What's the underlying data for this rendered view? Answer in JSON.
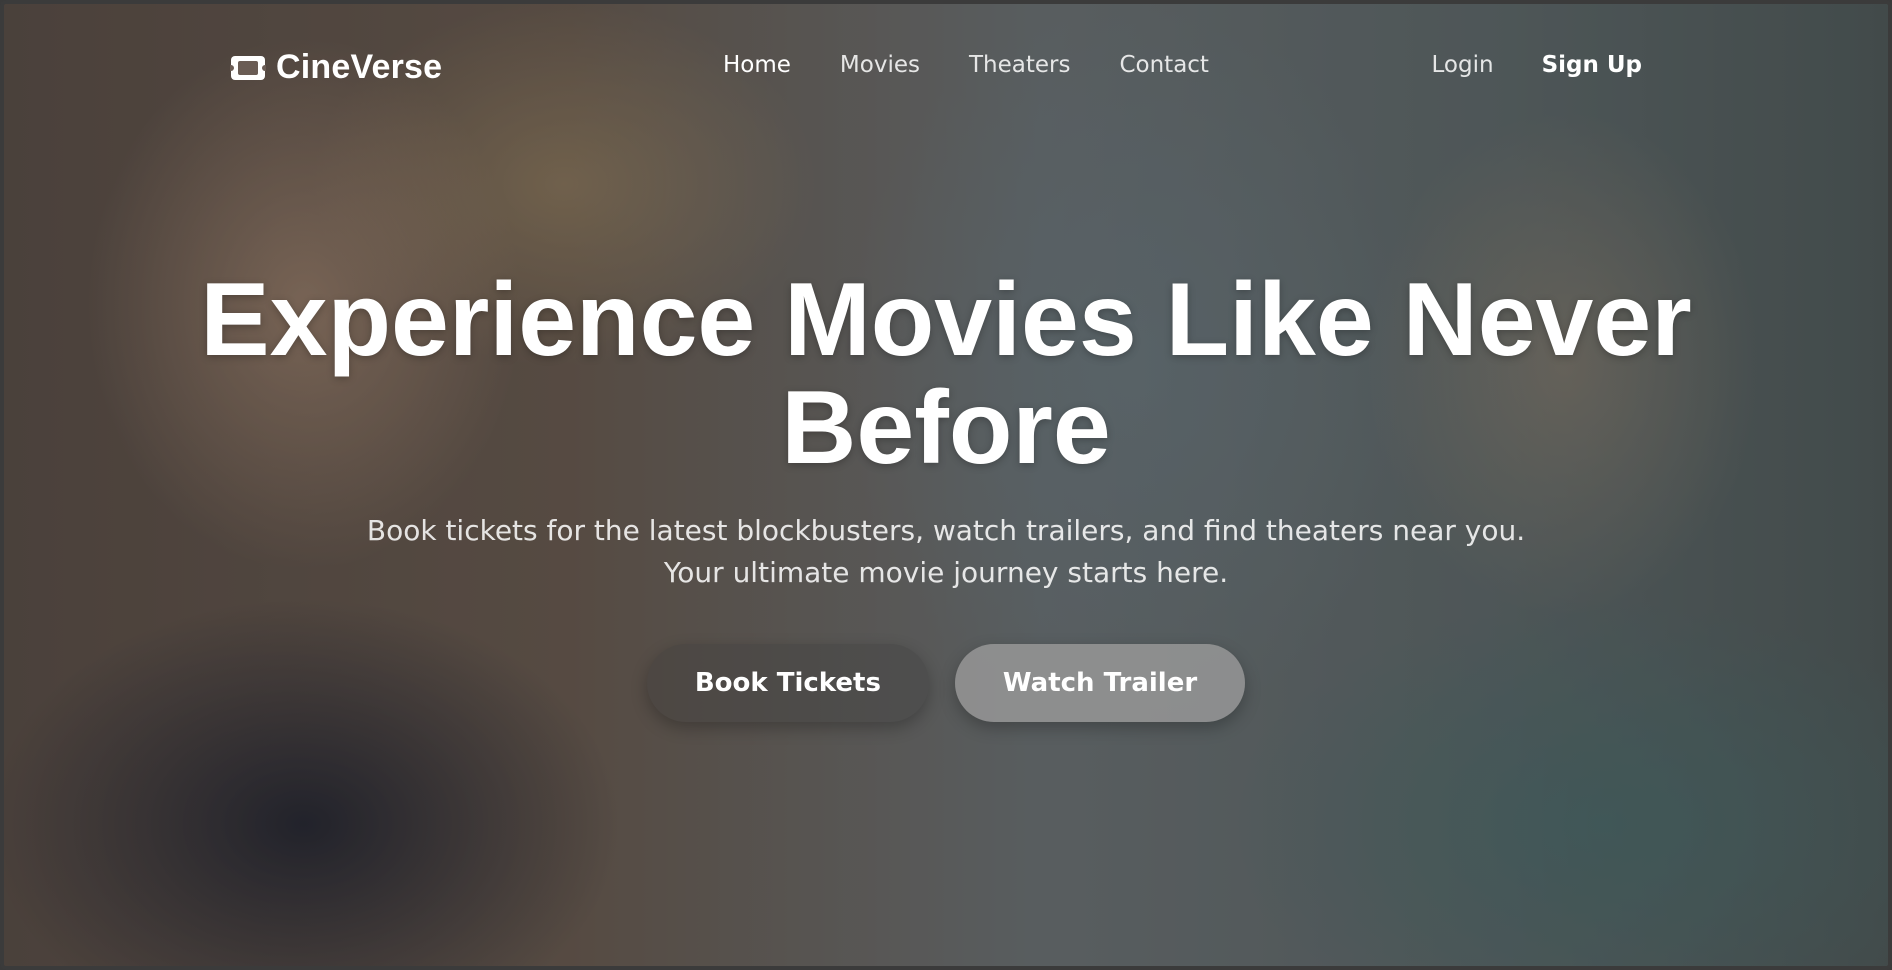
{
  "brand": {
    "name": "CineVerse",
    "icon": "ticket-icon"
  },
  "nav": {
    "items": [
      {
        "label": "Home",
        "active": true
      },
      {
        "label": "Movies",
        "active": false
      },
      {
        "label": "Theaters",
        "active": false
      },
      {
        "label": "Contact",
        "active": false
      }
    ]
  },
  "auth": {
    "login_label": "Login",
    "signup_label": "Sign Up"
  },
  "hero": {
    "title": "Experience Movies Like Never Before",
    "subtitle": "Book tickets for the latest blockbusters, watch trailers, and find theaters near you. Your ultimate movie journey starts here.",
    "primary_button": "Book Tickets",
    "secondary_button": "Watch Trailer"
  },
  "colors": {
    "text": "#ffffff",
    "secondary_button_bg": "#8c8c8c"
  }
}
